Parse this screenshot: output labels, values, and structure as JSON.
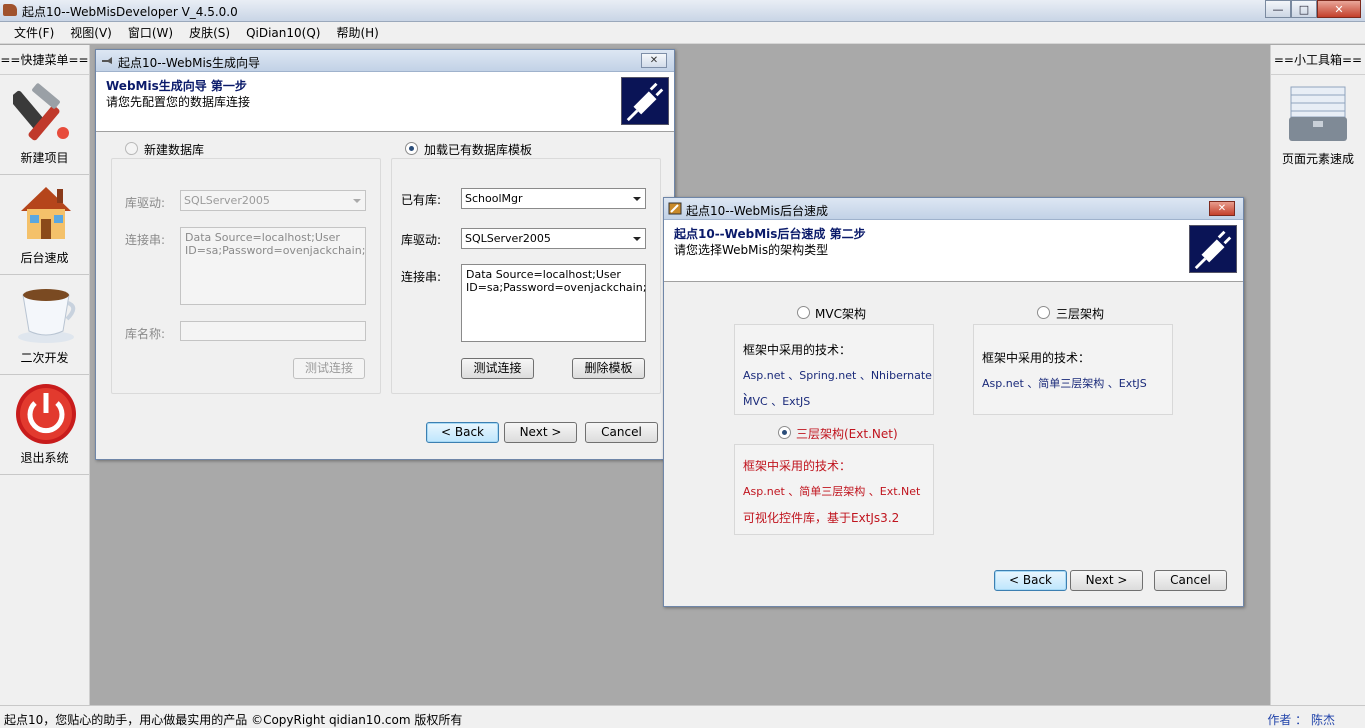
{
  "app": {
    "title": "起点10--WebMisDeveloper V_4.5.0.0",
    "window_buttons": [
      "minimize-icon",
      "maximize-icon",
      "close-icon"
    ]
  },
  "menu": [
    "文件(F)",
    "视图(V)",
    "窗口(W)",
    "皮肤(S)",
    "QiDian10(Q)",
    "帮助(H)"
  ],
  "left_sidebar": {
    "header": "==快捷菜单==",
    "items": [
      {
        "label": "新建项目",
        "icon": "tools-icon"
      },
      {
        "label": "后台速成",
        "icon": "house-icon"
      },
      {
        "label": "二次开发",
        "icon": "coffee-cup-icon"
      },
      {
        "label": "退出系统",
        "icon": "power-icon"
      }
    ]
  },
  "right_sidebar": {
    "header": "==小工具箱==",
    "items": [
      {
        "label": "页面元素速成",
        "icon": "toolbox-icon"
      }
    ]
  },
  "statusbar": {
    "left": "起点10，您贴心的助手，用心做最实用的产品    ©CopyRight qidian10.com 版权所有",
    "right": "作者 ： 陈杰"
  },
  "wizard": {
    "title": "起点10--WebMis生成向导",
    "heading": "WebMis生成向导  第一步",
    "subheading": "请您先配置您的数据库连接",
    "new_db": {
      "radio_label": "新建数据库",
      "selected": false,
      "driver_label": "库驱动:",
      "driver_value": "SQLServer2005",
      "conn_label": "连接串:",
      "conn_value": "Data Source=localhost;User ID=sa;Password=ovenjackchain;",
      "dbname_label": "库名称:",
      "test_button": "测试连接"
    },
    "load_template": {
      "radio_label": "加载已有数据库模板",
      "selected": true,
      "existing_label": "已有库:",
      "existing_value": "SchoolMgr",
      "driver_label": "库驱动:",
      "driver_value": "SQLServer2005",
      "conn_label": "连接串:",
      "conn_value": "Data Source=localhost;User ID=sa;Password=ovenjackchain;",
      "test_button": "测试连接",
      "delete_button": "删除模板"
    },
    "buttons": {
      "back": "< Back",
      "next": "Next >",
      "cancel": "Cancel"
    }
  },
  "backend": {
    "title": "起点10--WebMis后台速成",
    "heading": "起点10--WebMis后台速成  第二步",
    "subheading": "请您选择WebMis的架构类型",
    "options": [
      {
        "label": "MVC架构",
        "selected": false,
        "tech_title": "框架中采用的技术：",
        "lines": [
          "Asp.net 、Spring.net 、Nhibernate 、",
          "MVC 、ExtJS"
        ]
      },
      {
        "label": "三层架构",
        "selected": false,
        "tech_title": "框架中采用的技术：",
        "lines": [
          "Asp.net 、简单三层架构 、ExtJS"
        ]
      },
      {
        "label": "三层架构(Ext.Net)",
        "selected": true,
        "tech_title": "框架中采用的技术：",
        "lines": [
          "Asp.net 、简单三层架构 、Ext.Net",
          "可视化控件库，基于ExtJs3.2"
        ]
      }
    ],
    "buttons": {
      "back": "< Back",
      "next": "Next >",
      "cancel": "Cancel"
    }
  }
}
